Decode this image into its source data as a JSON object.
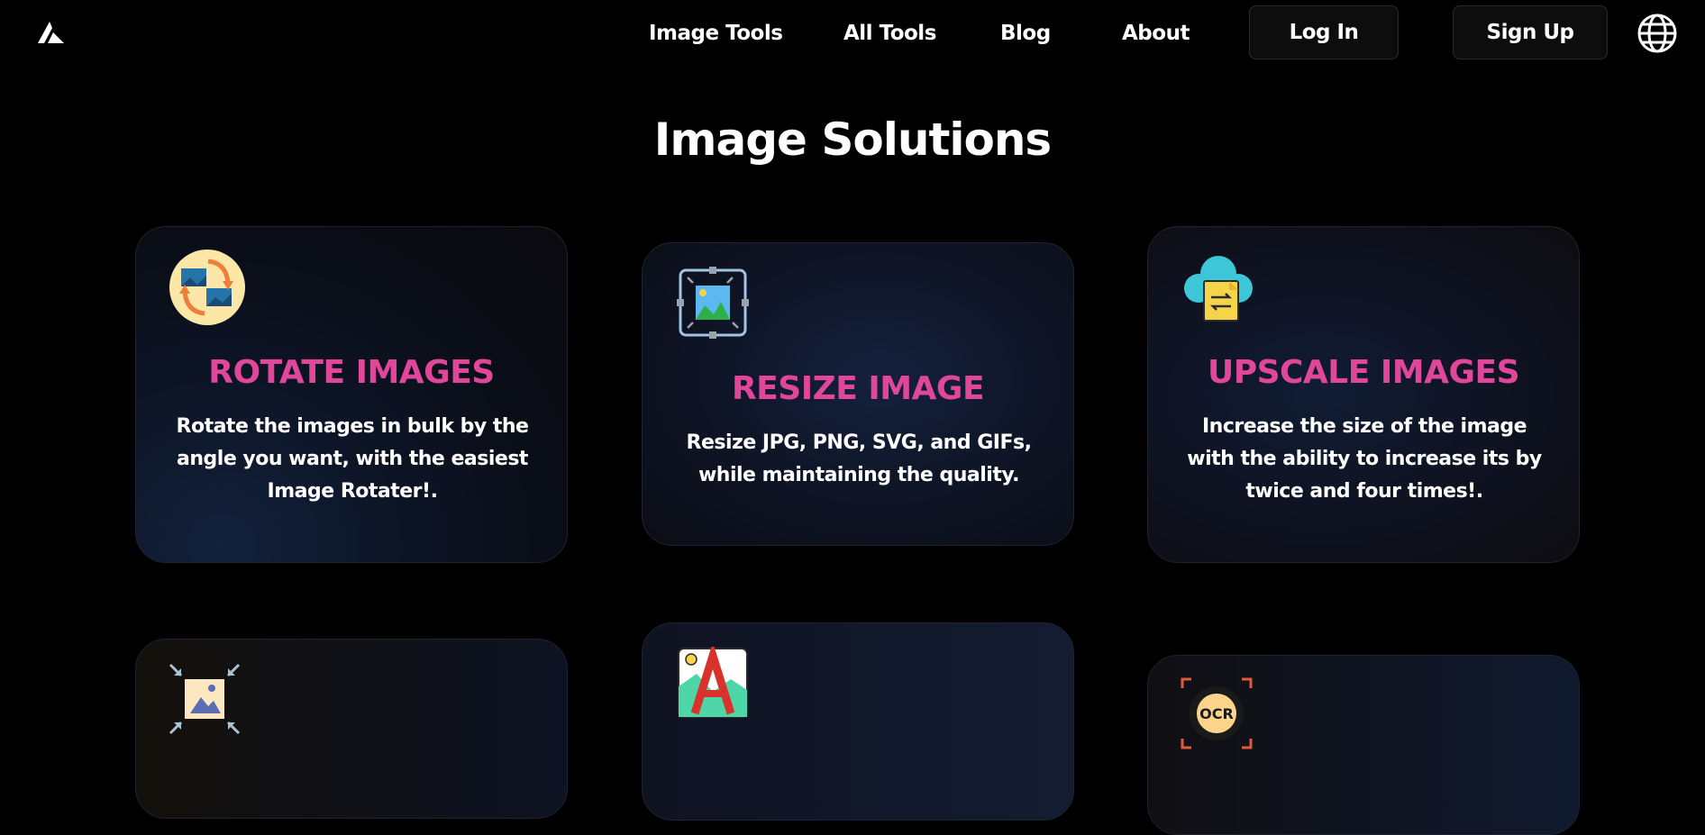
{
  "nav": {
    "links": [
      "Image Tools",
      "All Tools",
      "Blog",
      "About"
    ],
    "login_label": "Log In",
    "signup_label": "Sign Up",
    "logo_icon": "brand-logo-icon",
    "language_icon": "globe-icon"
  },
  "page": {
    "title": "Image Solutions"
  },
  "cards": [
    {
      "title": "ROTATE IMAGES",
      "description": "Rotate the images in bulk by the angle you want, with the easiest Image Rotater!.",
      "icon": "rotate-images-icon"
    },
    {
      "title": "RESIZE IMAGE",
      "description": "Resize JPG, PNG, SVG, and GIFs, while maintaining the quality.",
      "icon": "resize-image-icon"
    },
    {
      "title": "UPSCALE IMAGES",
      "description": "Increase the size of the image with the ability to increase its by twice and four times!.",
      "icon": "upscale-cloud-icon"
    },
    {
      "title": "",
      "description": "",
      "icon": "compress-image-icon"
    },
    {
      "title": "",
      "description": "",
      "icon": "text-on-image-icon"
    },
    {
      "title": "",
      "description": "",
      "icon": "ocr-icon",
      "icon_text": "OCR"
    }
  ],
  "colors": {
    "background": "#000000",
    "accent_title": "#e0479a",
    "text": "#ffffff"
  }
}
